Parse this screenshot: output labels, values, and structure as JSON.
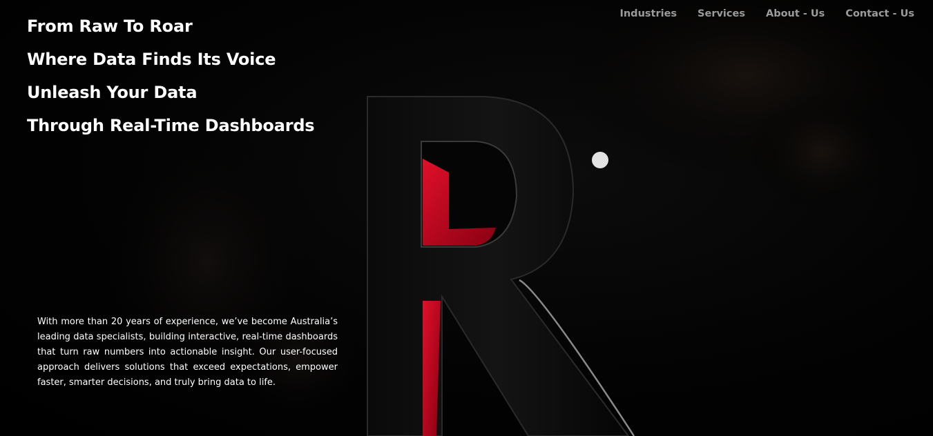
{
  "nav": {
    "items": [
      {
        "label": "Industries"
      },
      {
        "label": "Services"
      },
      {
        "label": "About - Us"
      },
      {
        "label": "Contact - Us"
      }
    ]
  },
  "hero": {
    "headlines": [
      "From Raw To Roar",
      "Where Data Finds Its Voice",
      "Unleash Your Data",
      "Through Real-Time Dashboards"
    ],
    "description": "With more than 20 years of experience, we’ve become Australia’s leading data specialists, building interactive, real-time dashboards that turn raw numbers into actionable insight. Our user-focused approach delivers solutions that exceed expectations, empower faster, smarter decisions, and truly bring data to life."
  },
  "colors": {
    "background": "#000000",
    "accent_red": "#c00018",
    "nav_text": "#9b9b9b",
    "text": "#ffffff"
  },
  "icons": {
    "logo": "r-logo-icon",
    "orb": "dot-icon"
  }
}
